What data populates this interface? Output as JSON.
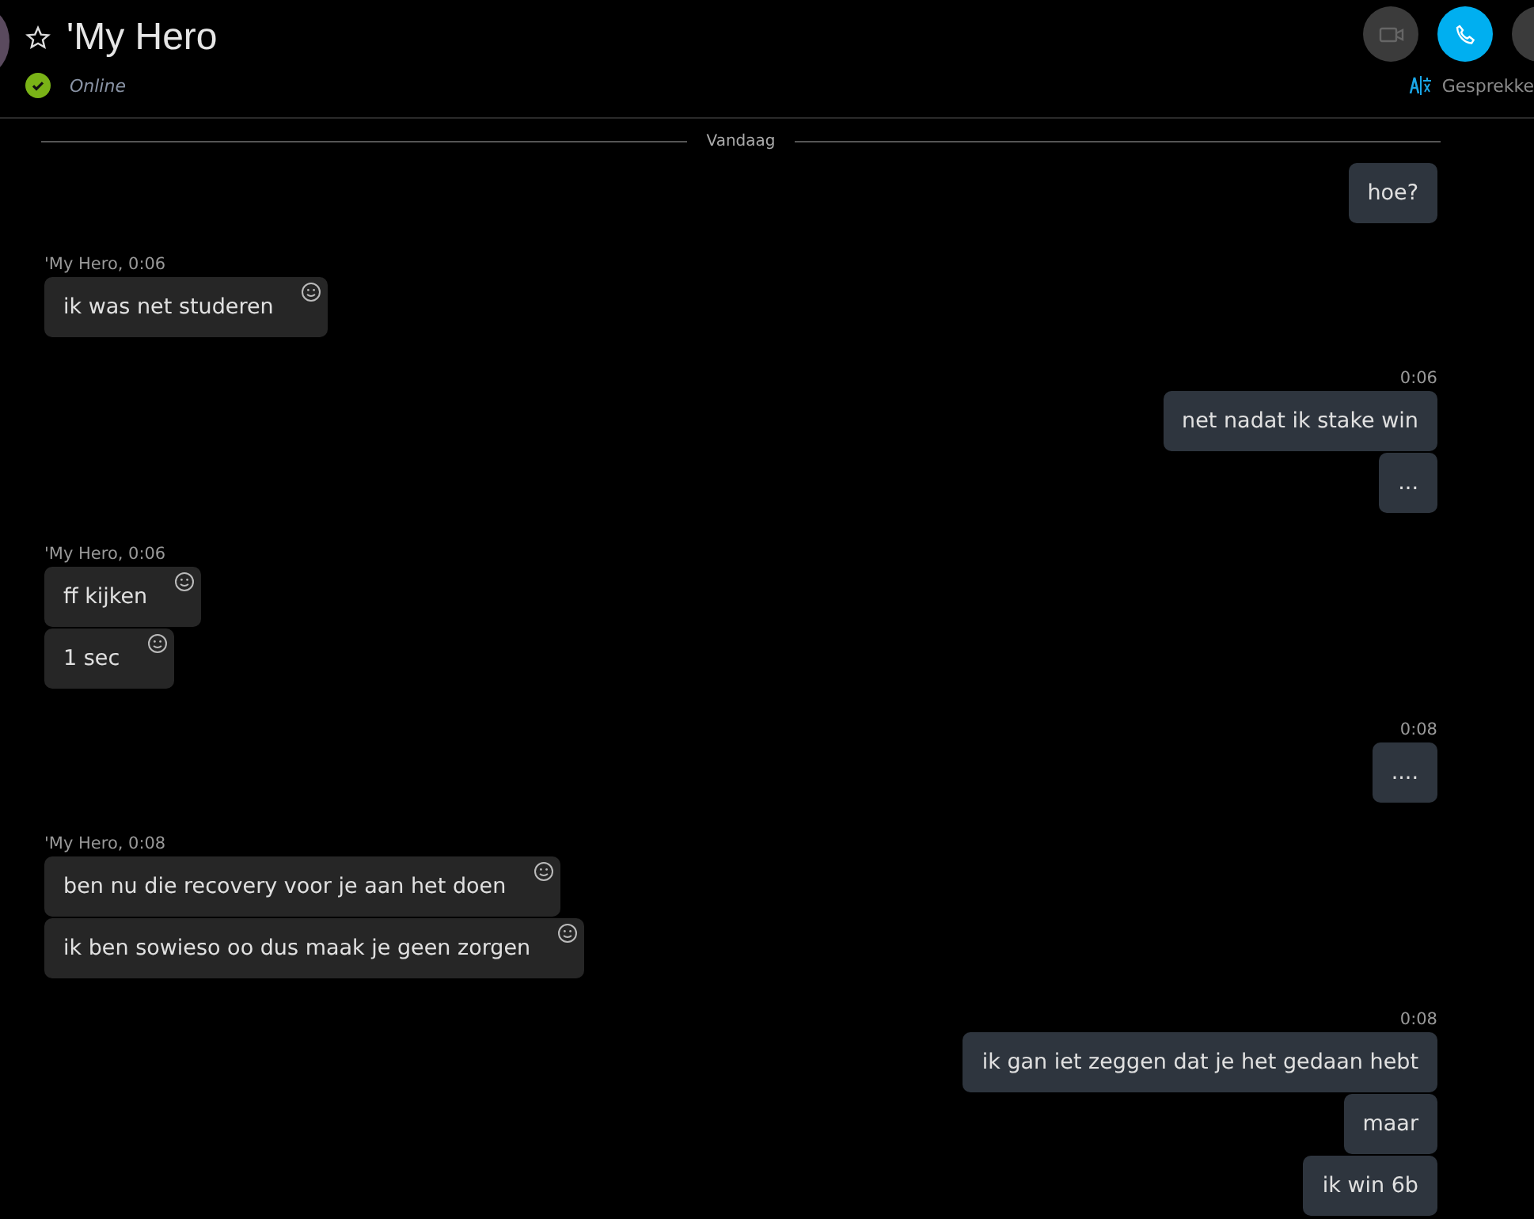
{
  "header": {
    "contact_name": "'My Hero",
    "favorite": false,
    "status": "Online",
    "translate_label": "Gesprekke"
  },
  "date_divider": "Vandaag",
  "groups": [
    {
      "kind": "outgoing",
      "bubbles": [
        {
          "text": "hoe?"
        }
      ]
    },
    {
      "kind": "incoming",
      "meta": "'My Hero, 0:06",
      "bubbles": [
        {
          "text": "ik was net studeren"
        }
      ]
    },
    {
      "kind": "outgoing",
      "meta": "0:06",
      "bubbles": [
        {
          "text": "net nadat ik stake win"
        },
        {
          "text": "..."
        }
      ]
    },
    {
      "kind": "incoming",
      "meta": "'My Hero, 0:06",
      "bubbles": [
        {
          "text": "ff kijken"
        },
        {
          "text": "1 sec"
        }
      ]
    },
    {
      "kind": "outgoing",
      "meta": "0:08",
      "bubbles": [
        {
          "text": "...."
        }
      ]
    },
    {
      "kind": "incoming",
      "meta": "'My Hero, 0:08",
      "bubbles": [
        {
          "text": "ben nu die recovery voor je aan het doen"
        },
        {
          "text": "ik ben sowieso oo dus maak je geen zorgen"
        }
      ]
    },
    {
      "kind": "outgoing",
      "meta": "0:08",
      "bubbles": [
        {
          "text": "ik gan iet zeggen dat je het gedaan hebt"
        },
        {
          "text": "maar"
        },
        {
          "text": "ik win 6b"
        }
      ]
    }
  ]
}
